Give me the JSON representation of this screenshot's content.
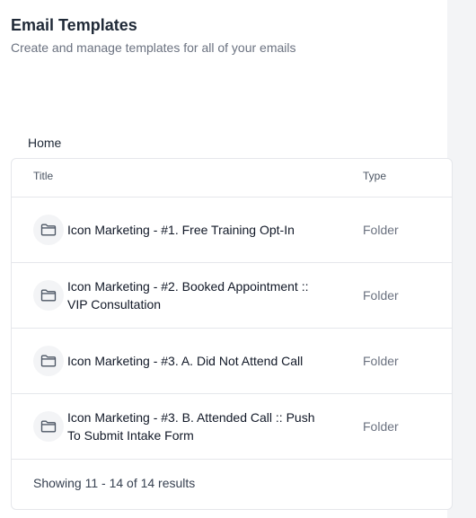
{
  "header": {
    "title": "Email Templates",
    "subtitle": "Create and manage templates for all of your emails"
  },
  "breadcrumb": {
    "home": "Home"
  },
  "table": {
    "columns": {
      "title": "Title",
      "type": "Type"
    },
    "rows": [
      {
        "title": "Icon Marketing - #1. Free Training Opt-In",
        "type": "Folder",
        "icon": "folder-icon"
      },
      {
        "title": "Icon Marketing - #2. Booked Appointment :: VIP Consultation",
        "type": "Folder",
        "icon": "folder-icon"
      },
      {
        "title": "Icon Marketing - #3. A. Did Not Attend Call",
        "type": "Folder",
        "icon": "folder-icon"
      },
      {
        "title": "Icon Marketing - #3. B. Attended Call :: Push To Submit Intake Form",
        "type": "Folder",
        "icon": "folder-icon"
      }
    ],
    "footer": "Showing 11 - 14 of 14 results"
  },
  "colors": {
    "title": "#1f2937",
    "muted": "#6b7280",
    "border": "#e5e7eb",
    "icon_bg": "#f3f4f6"
  }
}
